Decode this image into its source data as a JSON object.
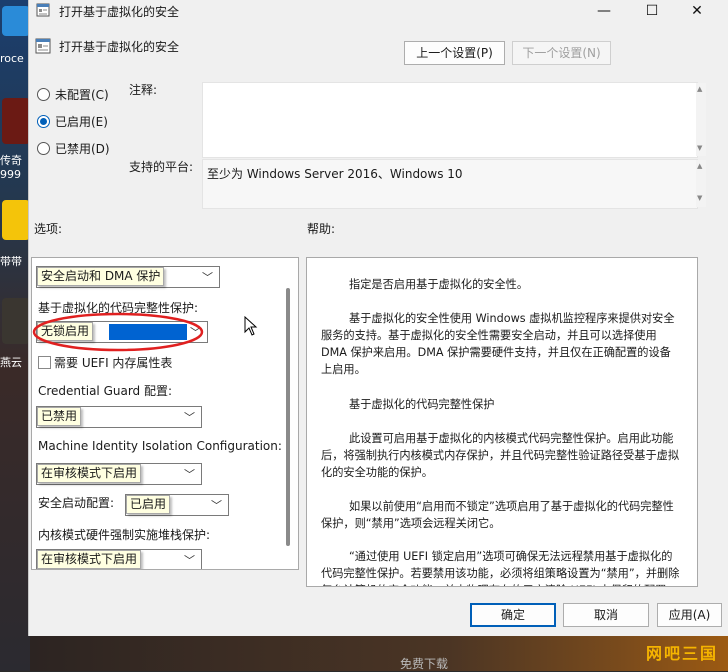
{
  "desktop": {
    "labels": [
      "roce",
      "传奇",
      "999",
      "带带",
      "燕云"
    ]
  },
  "window": {
    "title": "打开基于虚拟化的安全",
    "minimize": "—",
    "maximize": "☐",
    "close": "✕"
  },
  "header": {
    "title": "打开基于虚拟化的安全",
    "prev_label": "上一个设置(P)",
    "next_label": "下一个设置(N)"
  },
  "state": {
    "options": [
      {
        "label": "未配置(C)",
        "selected": false
      },
      {
        "label": "已启用(E)",
        "selected": true
      },
      {
        "label": "已禁用(D)",
        "selected": false
      }
    ]
  },
  "comment": {
    "label": "注释:",
    "value": ""
  },
  "platform": {
    "label": "支持的平台:",
    "value": "至少为 Windows Server 2016、Windows 10"
  },
  "options_panel": {
    "heading": "选项:",
    "platform_security": {
      "value": "安全启动和 DMA 保护"
    },
    "hvci_label": "基于虚拟化的代码完整性保护:",
    "hvci": {
      "value": "无锁启用"
    },
    "uefi_mat": {
      "label": "需要 UEFI 内存属性表",
      "checked": false
    },
    "credential_guard_label": "Credential Guard 配置:",
    "credential_guard": {
      "value": "已禁用"
    },
    "machine_identity_label": "Machine Identity Isolation Configuration:",
    "machine_identity": {
      "value": "在审核模式下启用"
    },
    "secure_launch_label": "安全启动配置:",
    "secure_launch": {
      "value": "已启用"
    },
    "kernel_stack_label": "内核模式硬件强制实施堆栈保护:",
    "kernel_stack": {
      "value": "在审核模式下启用"
    }
  },
  "help_panel": {
    "heading": "帮助:",
    "paragraphs": [
      "指定是否启用基于虚拟化的安全性。",
      "基于虚拟化的安全性使用 Windows 虚拟机监控程序来提供对安全服务的支持。基于虚拟化的安全性需要安全启动，并且可以选择使用 DMA 保护来启用。DMA 保护需要硬件支持，并且仅在正确配置的设备上启用。",
      "基于虚拟化的代码完整性保护",
      "此设置可启用基于虚拟化的内核模式代码完整性保护。启用此功能后，将强制执行内核模式内存保护，并且代码完整性验证路径受基于虚拟化的安全功能的保护。",
      "如果以前使用“启用而不锁定”选项启用了基于虚拟化的代码完整性保护，则“禁用”选项会远程关闭它。",
      "“通过使用 UEFI 锁定启用”选项可确保无法远程禁用基于虚拟化的代码完整性保护。若要禁用该功能，必须将组策略设置为“禁用”，并删除每台计算机的安全功能，并由物理存在的用户清除 UEFI 中保留的配置。"
    ]
  },
  "footer": {
    "ok_label": "确定",
    "cancel_label": "取消",
    "apply_label": "应用(A)"
  },
  "watermark": {
    "text": "网吧三国",
    "sub": "免费下载"
  },
  "colors": {
    "accent": "#005fb8",
    "highlight": "#0063d1",
    "annotation": "#e02020",
    "tooltip": "#ffffe1"
  }
}
